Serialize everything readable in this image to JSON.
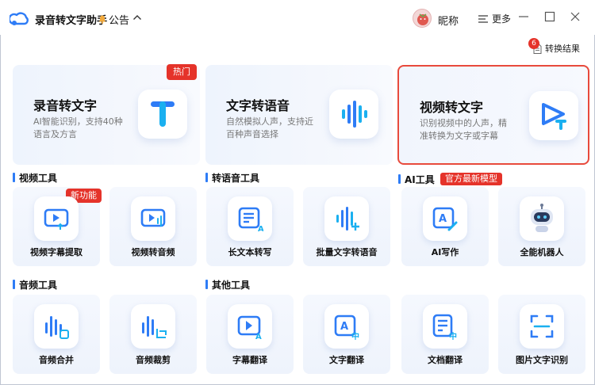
{
  "app": {
    "title": "录音转文字助手",
    "announcement": "公告",
    "user_name": "昵称",
    "more_label": "更多",
    "results_label": "转换结果",
    "results_count": "6"
  },
  "colors": {
    "accent": "#2e7cf6",
    "badge": "#e5332a",
    "active_border": "#e84a3c"
  },
  "features": [
    {
      "title": "录音转文字",
      "desc": "AI智能识别，支持40种语言及方言",
      "badge": "热门",
      "icon": "t-letter-icon"
    },
    {
      "title": "文字转语音",
      "desc": "自然模拟人声，支持近百种声音选择",
      "icon": "soundwave-icon"
    },
    {
      "title": "视频转文字",
      "desc": "识别视频中的人声，精准转换为文字或字幕",
      "icon": "video-text-icon"
    }
  ],
  "sections": {
    "video_tools": "视频工具",
    "speech_tools": "转语音工具",
    "ai_tools": "AI工具",
    "ai_tag": "官方最新模型",
    "audio_tools": "音频工具",
    "other_tools": "其他工具"
  },
  "tools": {
    "subtitle_extract": {
      "label": "视频字幕提取",
      "badge": "新功能"
    },
    "video_to_audio": {
      "label": "视频转音频"
    },
    "long_text": {
      "label": "长文本转写"
    },
    "batch_tts": {
      "label": "批量文字转语音"
    },
    "ai_writing": {
      "label": "AI写作"
    },
    "robot": {
      "label": "全能机器人"
    },
    "audio_merge": {
      "label": "音频合并"
    },
    "audio_cut": {
      "label": "音频裁剪"
    },
    "subtitle_translate": {
      "label": "字幕翻译"
    },
    "text_translate": {
      "label": "文字翻译"
    },
    "doc_translate": {
      "label": "文档翻译"
    },
    "image_ocr": {
      "label": "图片文字识别"
    }
  }
}
